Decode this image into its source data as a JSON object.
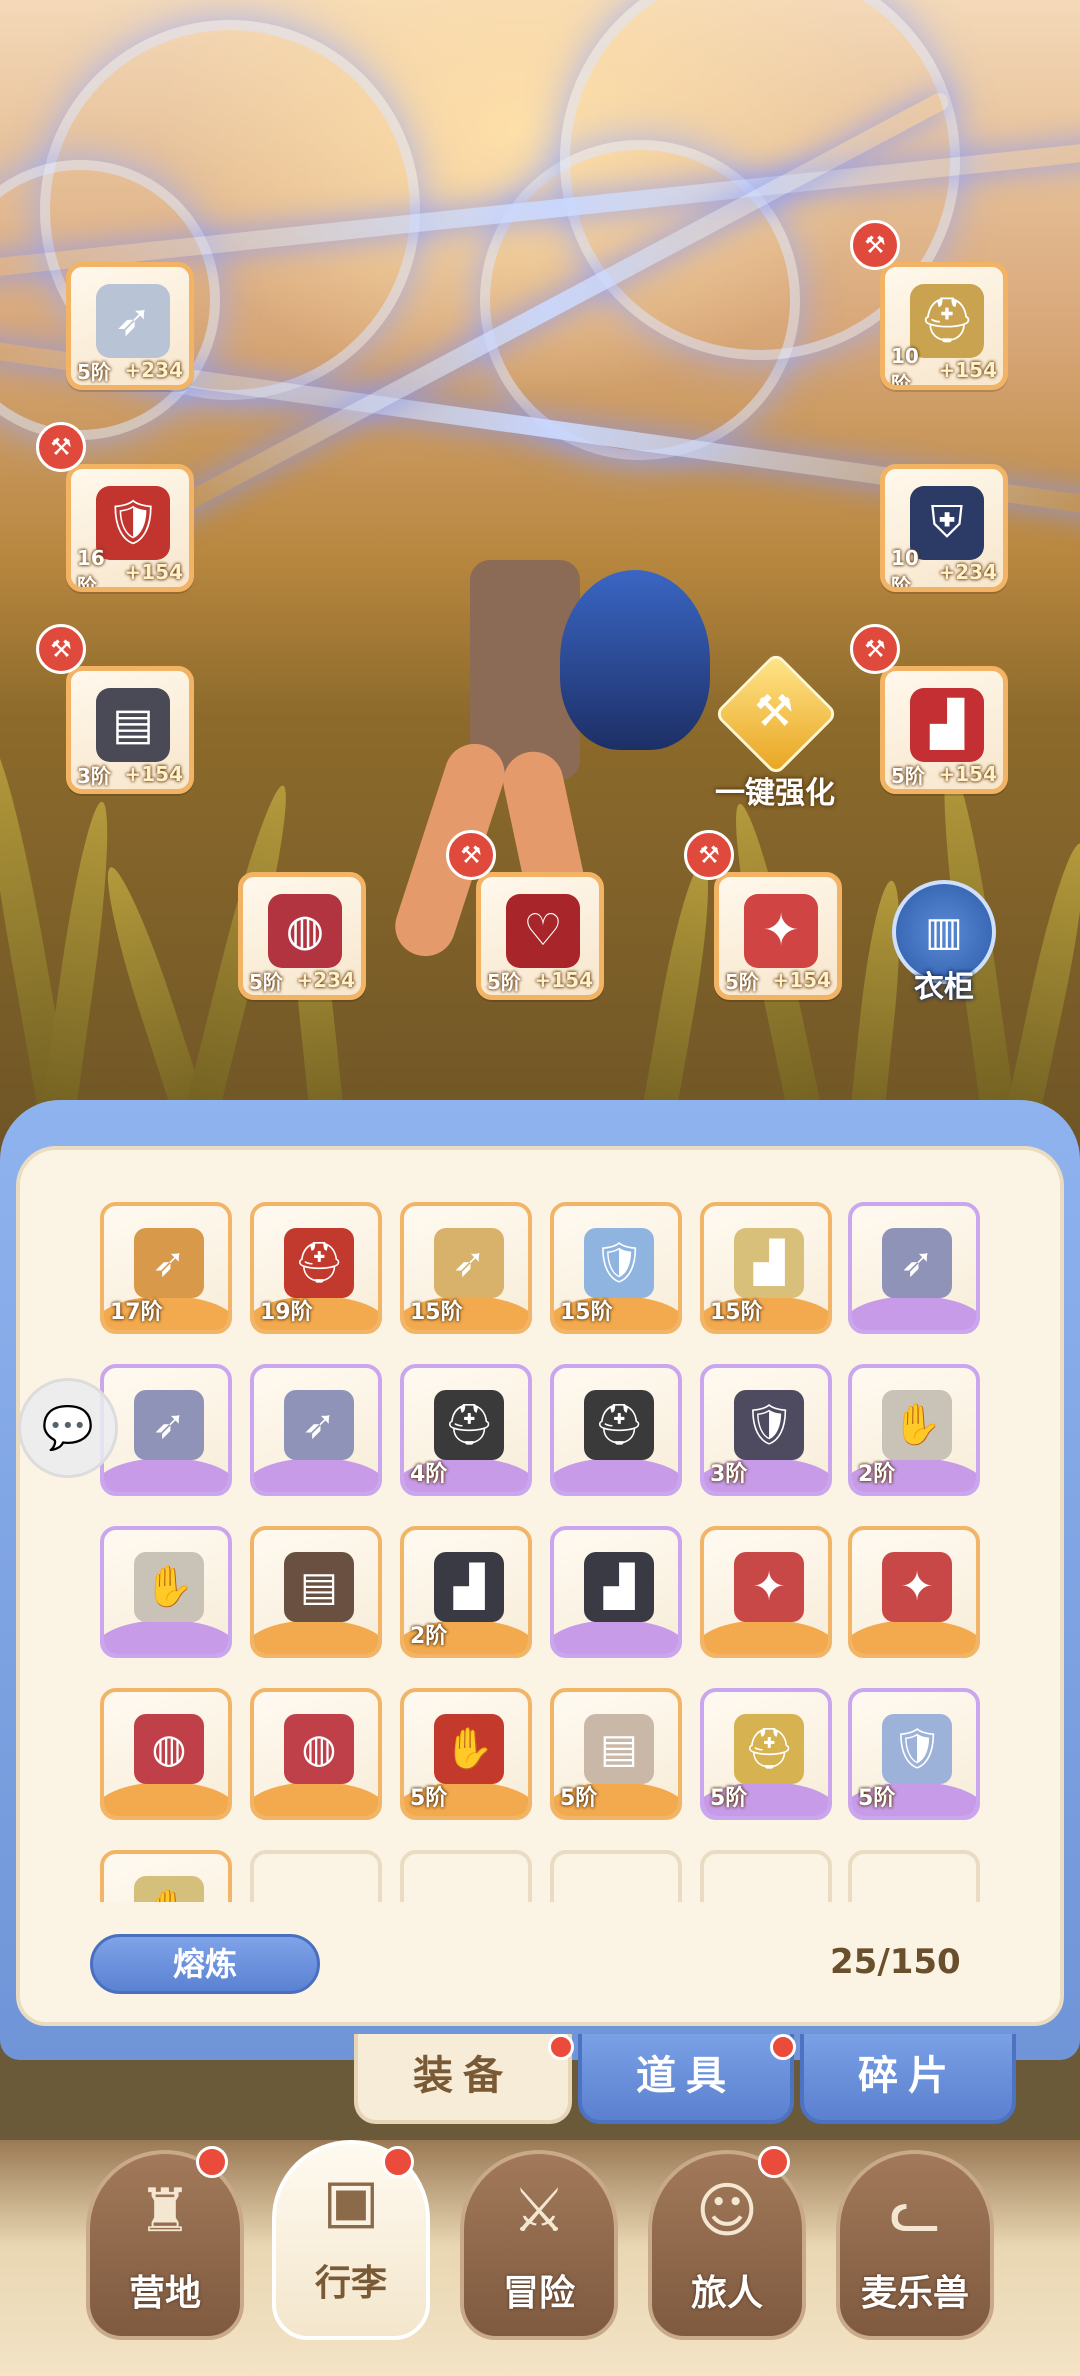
{
  "equipment_slots": [
    {
      "id": "bow",
      "tier": "5阶",
      "bonus": "+234",
      "badge": false,
      "icon": "bow-icon",
      "color": "#b9c3d6"
    },
    {
      "id": "helmet",
      "tier": "10阶",
      "bonus": "+154",
      "badge": true,
      "icon": "helmet-icon",
      "color": "#c9a34f"
    },
    {
      "id": "chest",
      "tier": "16阶",
      "bonus": "+154",
      "badge": true,
      "icon": "chest-armor-icon",
      "color": "#c2342e"
    },
    {
      "id": "shoulder",
      "tier": "10阶",
      "bonus": "+234",
      "badge": false,
      "icon": "shoulder-armor-icon",
      "color": "#2c3a66"
    },
    {
      "id": "pants",
      "tier": "3阶",
      "bonus": "+154",
      "badge": true,
      "icon": "pants-icon",
      "color": "#4a4a57"
    },
    {
      "id": "boots",
      "tier": "5阶",
      "bonus": "+154",
      "badge": true,
      "icon": "boots-icon",
      "color": "#c32f32"
    },
    {
      "id": "ring",
      "tier": "5阶",
      "bonus": "+234",
      "badge": false,
      "icon": "ring-icon",
      "color": "#b23440"
    },
    {
      "id": "necklace",
      "tier": "5阶",
      "bonus": "+154",
      "badge": true,
      "icon": "necklace-icon",
      "color": "#a8262a"
    },
    {
      "id": "amulet",
      "tier": "5阶",
      "bonus": "+154",
      "badge": true,
      "icon": "amulet-icon",
      "color": "#d04444"
    }
  ],
  "quick_strengthen": {
    "label": "一键强化"
  },
  "wardrobe": {
    "label": "衣柜"
  },
  "inventory": {
    "items": [
      {
        "tier": "17阶",
        "rarity": "orange",
        "icon": "bow-icon",
        "color": "#d89a4a"
      },
      {
        "tier": "19阶",
        "rarity": "orange",
        "icon": "helmet-icon",
        "color": "#c23a2e"
      },
      {
        "tier": "15阶",
        "rarity": "orange",
        "icon": "bow-icon",
        "color": "#d8b26a"
      },
      {
        "tier": "15阶",
        "rarity": "orange",
        "icon": "chest-armor-icon",
        "color": "#8fb4e0"
      },
      {
        "tier": "15阶",
        "rarity": "orange",
        "icon": "boots-icon",
        "color": "#d9c07a"
      },
      {
        "tier": "",
        "rarity": "purple",
        "icon": "bow-icon",
        "color": "#8f93b8"
      },
      {
        "tier": "",
        "rarity": "purple",
        "icon": "bow-icon",
        "color": "#8f93b8"
      },
      {
        "tier": "",
        "rarity": "purple",
        "icon": "bow-icon",
        "color": "#8f93b8"
      },
      {
        "tier": "4阶",
        "rarity": "purple",
        "icon": "helmet-icon",
        "color": "#3a3a3a"
      },
      {
        "tier": "",
        "rarity": "purple",
        "icon": "helmet-icon",
        "color": "#3a3a3a"
      },
      {
        "tier": "3阶",
        "rarity": "purple",
        "icon": "chest-armor-icon",
        "color": "#4e4a60"
      },
      {
        "tier": "2阶",
        "rarity": "purple",
        "icon": "gauntlet-icon",
        "color": "#c9c2b6"
      },
      {
        "tier": "",
        "rarity": "purple",
        "icon": "gauntlet-icon",
        "color": "#c9c2b6"
      },
      {
        "tier": "",
        "rarity": "orange",
        "icon": "pants-icon",
        "color": "#6a5040"
      },
      {
        "tier": "2阶",
        "rarity": "orange",
        "icon": "boots-icon",
        "color": "#3a3a44"
      },
      {
        "tier": "",
        "rarity": "purple",
        "icon": "boots-icon",
        "color": "#3a3a44"
      },
      {
        "tier": "",
        "rarity": "orange",
        "icon": "amulet-icon",
        "color": "#c84848"
      },
      {
        "tier": "",
        "rarity": "orange",
        "icon": "amulet-icon",
        "color": "#c84848"
      },
      {
        "tier": "",
        "rarity": "orange",
        "icon": "ring-icon",
        "color": "#c0404a"
      },
      {
        "tier": "",
        "rarity": "orange",
        "icon": "ring-icon",
        "color": "#c0404a"
      },
      {
        "tier": "5阶",
        "rarity": "orange",
        "icon": "gauntlet-icon",
        "color": "#c33a2c"
      },
      {
        "tier": "5阶",
        "rarity": "orange",
        "icon": "pants-icon",
        "color": "#c9b8a8"
      },
      {
        "tier": "5阶",
        "rarity": "purple",
        "icon": "helmet-icon",
        "color": "#d6b250"
      },
      {
        "tier": "5阶",
        "rarity": "purple",
        "icon": "chest-armor-icon",
        "color": "#9cb2d8"
      },
      {
        "tier": "",
        "rarity": "orange",
        "icon": "gauntlet-icon",
        "color": "#d4c07a"
      },
      {
        "tier": "",
        "rarity": "empty",
        "icon": "",
        "color": ""
      },
      {
        "tier": "",
        "rarity": "empty",
        "icon": "",
        "color": ""
      },
      {
        "tier": "",
        "rarity": "empty",
        "icon": "",
        "color": ""
      },
      {
        "tier": "",
        "rarity": "empty",
        "icon": "",
        "color": ""
      },
      {
        "tier": "",
        "rarity": "empty",
        "icon": "",
        "color": ""
      }
    ]
  },
  "smelt_button": {
    "label": "熔炼"
  },
  "capacity": {
    "text": "25/150"
  },
  "tabs": [
    {
      "label": "装备",
      "active": true,
      "badge": true
    },
    {
      "label": "道具",
      "active": false,
      "badge": true
    },
    {
      "label": "碎片",
      "active": false,
      "badge": false
    }
  ],
  "bottom_nav": [
    {
      "label": "营地",
      "icon": "castle-icon",
      "active": false,
      "badge": true
    },
    {
      "label": "行李",
      "icon": "chest-icon",
      "active": true,
      "badge": true
    },
    {
      "label": "冒险",
      "icon": "crossed-swords-icon",
      "active": false,
      "badge": false
    },
    {
      "label": "旅人",
      "icon": "traveler-icon",
      "active": false,
      "badge": true
    },
    {
      "label": "麦乐兽",
      "icon": "cat-icon",
      "active": false,
      "badge": false
    }
  ],
  "colors": {
    "accent_blue": "#6f95d8",
    "orange_rarity": "#f2b466",
    "purple_rarity": "#c9a6ee",
    "badge_red": "#e04a3c"
  }
}
